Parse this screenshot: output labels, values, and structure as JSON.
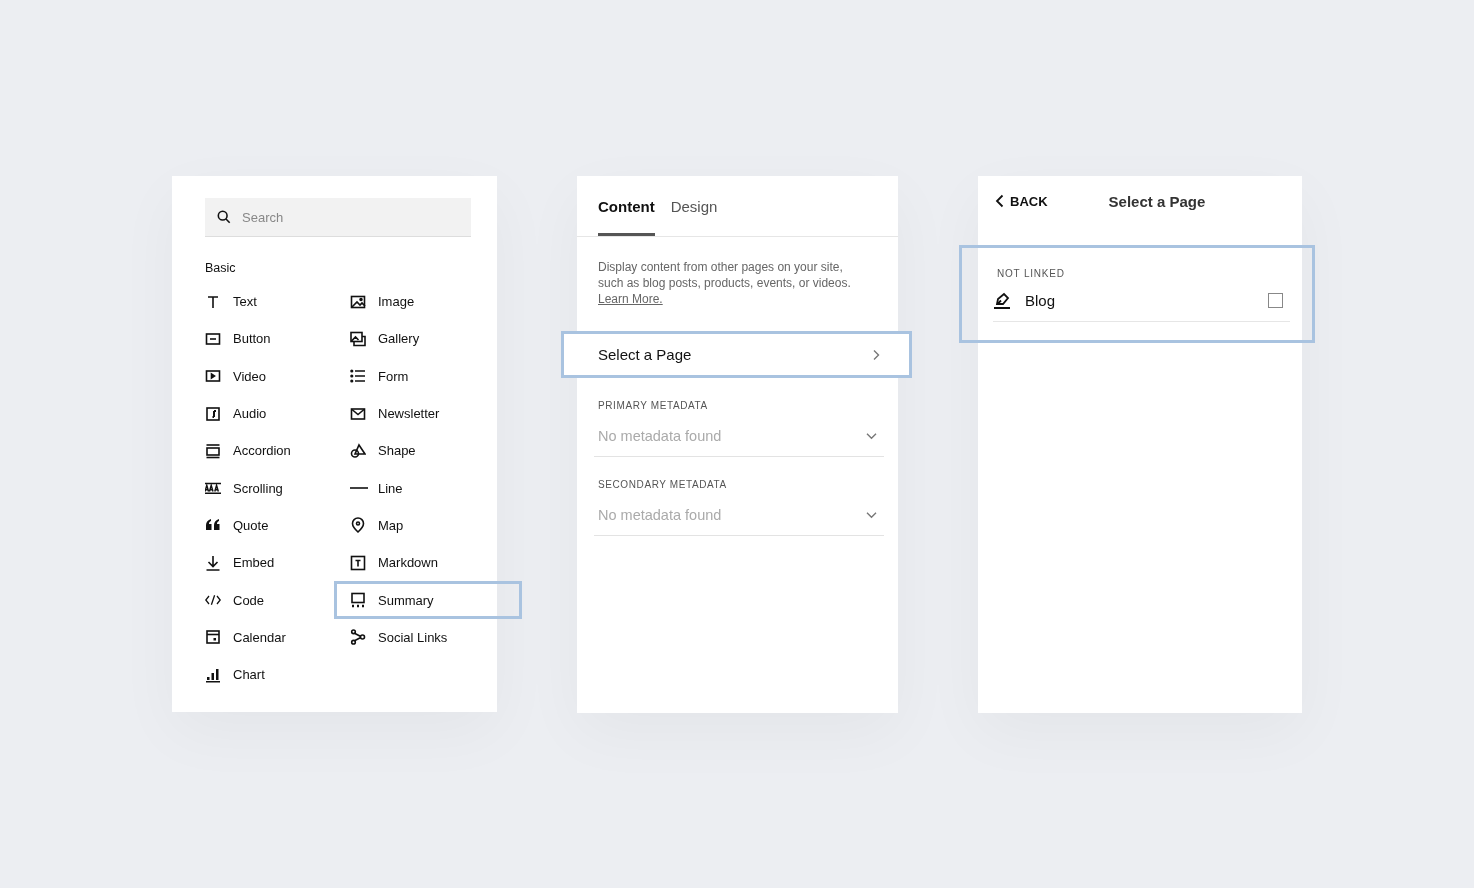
{
  "blocks_panel": {
    "search": {
      "placeholder": "Search"
    },
    "section_title": "Basic",
    "items": [
      {
        "label": "Text",
        "highlighted": false
      },
      {
        "label": "Image",
        "highlighted": false
      },
      {
        "label": "Button",
        "highlighted": false
      },
      {
        "label": "Gallery",
        "highlighted": false
      },
      {
        "label": "Video",
        "highlighted": false
      },
      {
        "label": "Form",
        "highlighted": false
      },
      {
        "label": "Audio",
        "highlighted": false
      },
      {
        "label": "Newsletter",
        "highlighted": false
      },
      {
        "label": "Accordion",
        "highlighted": false
      },
      {
        "label": "Shape",
        "highlighted": false
      },
      {
        "label": "Scrolling",
        "highlighted": false
      },
      {
        "label": "Line",
        "highlighted": false
      },
      {
        "label": "Quote",
        "highlighted": false
      },
      {
        "label": "Map",
        "highlighted": false
      },
      {
        "label": "Embed",
        "highlighted": false
      },
      {
        "label": "Markdown",
        "highlighted": false
      },
      {
        "label": "Code",
        "highlighted": false
      },
      {
        "label": "Summary",
        "highlighted": true
      },
      {
        "label": "Calendar",
        "highlighted": false
      },
      {
        "label": "Social Links",
        "highlighted": false
      },
      {
        "label": "Chart",
        "highlighted": false
      }
    ]
  },
  "summary_panel": {
    "tabs": [
      {
        "label": "Content",
        "selected": true
      },
      {
        "label": "Design",
        "selected": false
      }
    ],
    "description": "Display content from other pages on your site, such as blog posts, products, events, or videos.",
    "learn_more": "Learn More.",
    "select_row": {
      "label": "Select a Page",
      "highlighted": true
    },
    "dropdowns": [
      {
        "label": "PRIMARY METADATA",
        "placeholder": "No metadata found"
      },
      {
        "label": "SECONDARY METADATA",
        "placeholder": "No metadata found"
      }
    ]
  },
  "page_panel": {
    "back": "BACK",
    "title": "Select a Page",
    "section": {
      "label": "NOT LINKED",
      "highlighted": true,
      "pages": [
        {
          "label": "Blog",
          "checked": false
        }
      ]
    }
  }
}
